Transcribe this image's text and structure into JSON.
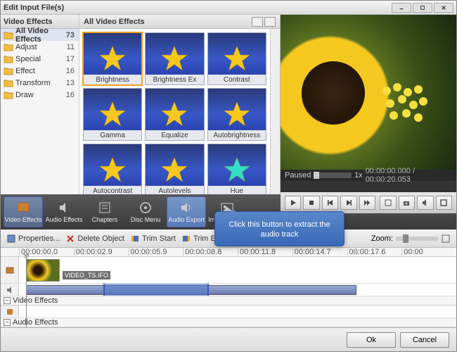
{
  "window": {
    "title": "Edit Input File(s)"
  },
  "sidebar": {
    "header": "Video Effects",
    "items": [
      {
        "label": "All Video Effects",
        "count": "73"
      },
      {
        "label": "Adjust",
        "count": "11"
      },
      {
        "label": "Special",
        "count": "17"
      },
      {
        "label": "Effect",
        "count": "16"
      },
      {
        "label": "Transform",
        "count": "13"
      },
      {
        "label": "Draw",
        "count": "16"
      }
    ]
  },
  "effects": {
    "header": "All Video Effects",
    "items": [
      "Brightness",
      "Brightness Ex",
      "Contrast",
      "Gamma",
      "Equalize",
      "Autobrightness",
      "Autocontrast",
      "Autolevels",
      "Hue"
    ],
    "hue_star_color": "#30e0c8",
    "star_color": "#f5c820"
  },
  "preview": {
    "status": "Paused",
    "speed": "1x",
    "time_current": "00:00:00.000",
    "time_total": "00:00:20.053"
  },
  "toolbar": {
    "items": [
      {
        "label": "Video Effects",
        "key": "video-effects"
      },
      {
        "label": "Audio Effects",
        "key": "audio-effects"
      },
      {
        "label": "Chapters",
        "key": "chapters"
      },
      {
        "label": "Disc Menu",
        "key": "disc-menu"
      },
      {
        "label": "Audio Export",
        "key": "audio-export"
      },
      {
        "label": "Image Export",
        "key": "image-export"
      }
    ]
  },
  "editbar": {
    "properties": "Properties...",
    "delete": "Delete Object",
    "trim_start": "Trim Start",
    "trim_end": "Trim End",
    "zoom": "Zoom:"
  },
  "timeline": {
    "marks": [
      "00:00:00.0",
      "00:00:02.9",
      "00:00:05.9",
      "00:00:08.8",
      "00:00:11.8",
      "00:00:14.7",
      "00:00:17.6",
      "00:00"
    ],
    "clip_name": "VIDEO_TS.IFO",
    "sections": {
      "video_effects": "Video Effects",
      "audio_effects": "Audio Effects"
    }
  },
  "callout": {
    "text": "Click this button to extract the audio track"
  },
  "buttons": {
    "ok": "Ok",
    "cancel": "Cancel"
  }
}
